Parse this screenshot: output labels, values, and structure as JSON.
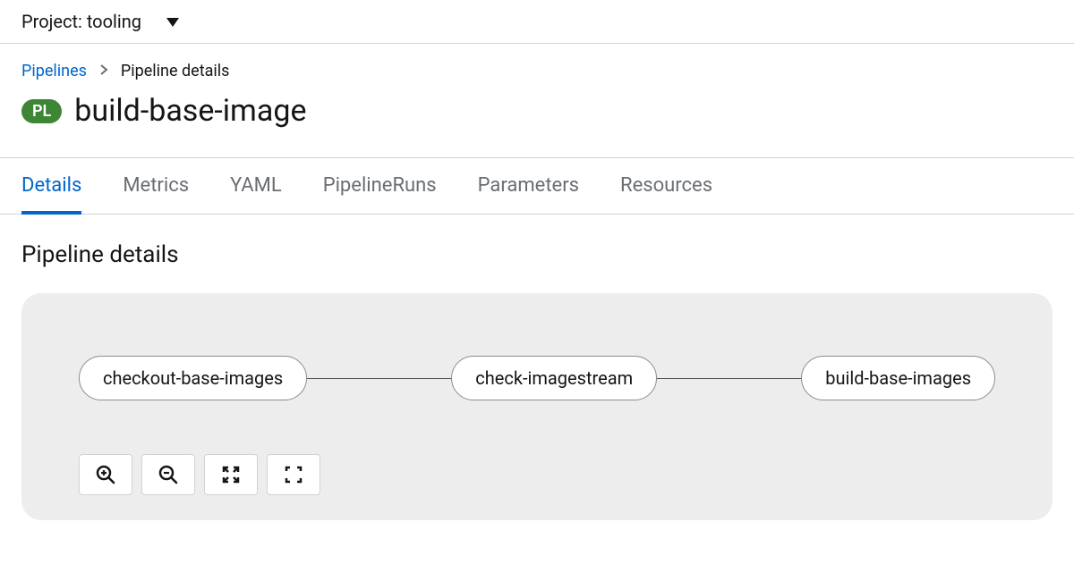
{
  "project_selector": {
    "label": "Project: tooling"
  },
  "breadcrumb": {
    "root": "Pipelines",
    "current": "Pipeline details"
  },
  "header": {
    "badge": "PL",
    "title": "build-base-image"
  },
  "tabs": [
    {
      "label": "Details",
      "active": true
    },
    {
      "label": "Metrics",
      "active": false
    },
    {
      "label": "YAML",
      "active": false
    },
    {
      "label": "PipelineRuns",
      "active": false
    },
    {
      "label": "Parameters",
      "active": false
    },
    {
      "label": "Resources",
      "active": false
    }
  ],
  "section": {
    "title": "Pipeline details"
  },
  "graph": {
    "nodes": [
      {
        "label": "checkout-base-images"
      },
      {
        "label": "check-imagestream"
      },
      {
        "label": "build-base-images"
      }
    ]
  },
  "toolbar": {
    "zoom_in": "zoom-in",
    "zoom_out": "zoom-out",
    "fit": "fit",
    "fullscreen": "fullscreen"
  }
}
